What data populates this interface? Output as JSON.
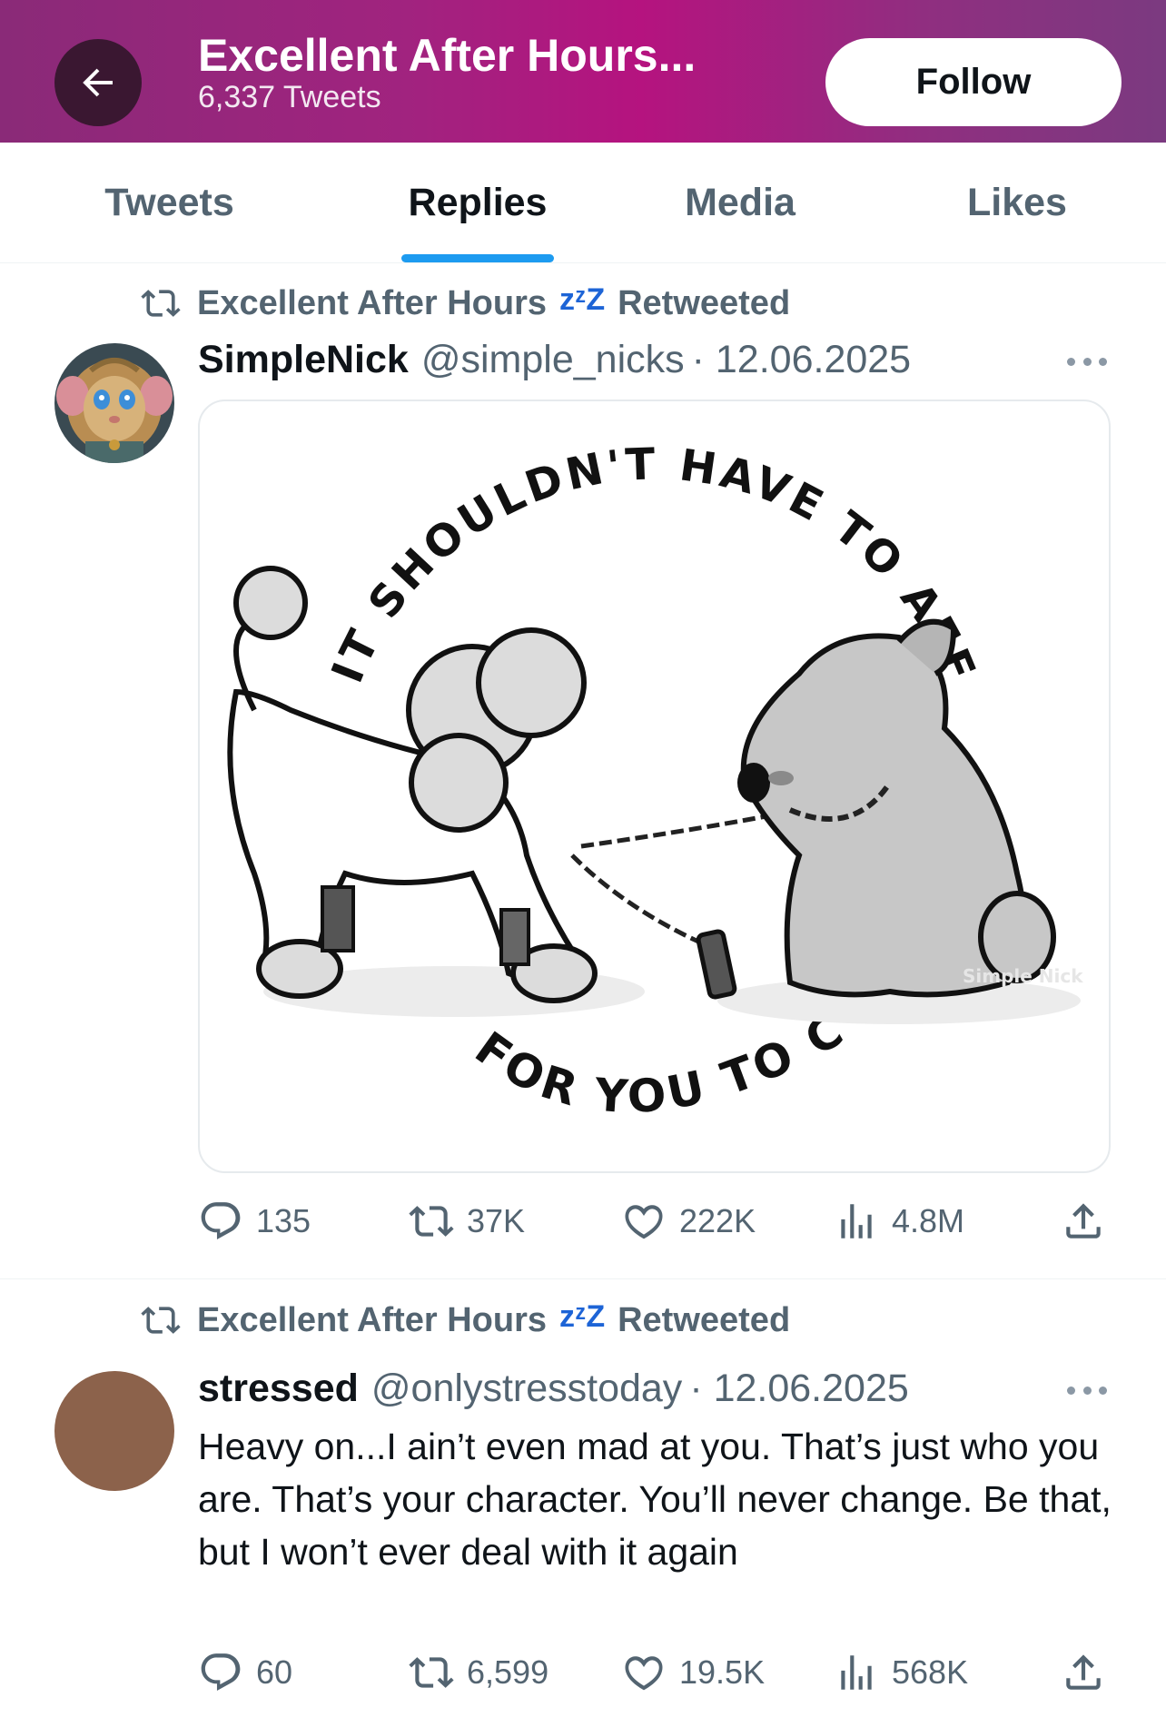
{
  "header": {
    "title": "Excellent After Hours...",
    "subtitle": "6,337 Tweets",
    "follow_label": "Follow"
  },
  "tabs": [
    {
      "label": "Tweets"
    },
    {
      "label": "Replies",
      "active": true
    },
    {
      "label": "Media"
    },
    {
      "label": "Likes"
    }
  ],
  "tweets": [
    {
      "retweeted_by": "Excellent After Hours",
      "retweet_emoji": "zᶻZ",
      "retweeted_label": "Retweeted",
      "name": "SimpleNick",
      "handle": "@simple_nicks",
      "date": "· 12.06.2025",
      "image_text": {
        "top": "IT SHOULDN'T HAVE TO AFFECT YOU",
        "bottom": "FOR YOU TO CARE.",
        "signature": "Simple Nick"
      },
      "replies": "135",
      "retweets": "37K",
      "likes": "222K",
      "views": "4.8M"
    },
    {
      "retweeted_by": "Excellent After Hours",
      "retweet_emoji": "zᶻZ",
      "retweeted_label": "Retweeted",
      "name": "stressed",
      "handle": "@onlystresstoday",
      "date": "· 12.06.2025",
      "text": "Heavy on...I ain’t even mad at you. That’s just who you are. That’s your character. You’ll never change. Be that, but I won’t ever deal with it again",
      "replies": "60",
      "retweets": "6,599",
      "likes": "19.5K",
      "views": "568K"
    }
  ],
  "colors": {
    "accent": "#1d9bf0",
    "header_gradient": "#b5137f",
    "secondary_text": "#536471",
    "avatar_brown": "#8c624b"
  },
  "icons": [
    "back-arrow-icon",
    "retweet-icon",
    "more-icon",
    "reply-icon",
    "like-icon",
    "views-icon",
    "share-icon"
  ]
}
